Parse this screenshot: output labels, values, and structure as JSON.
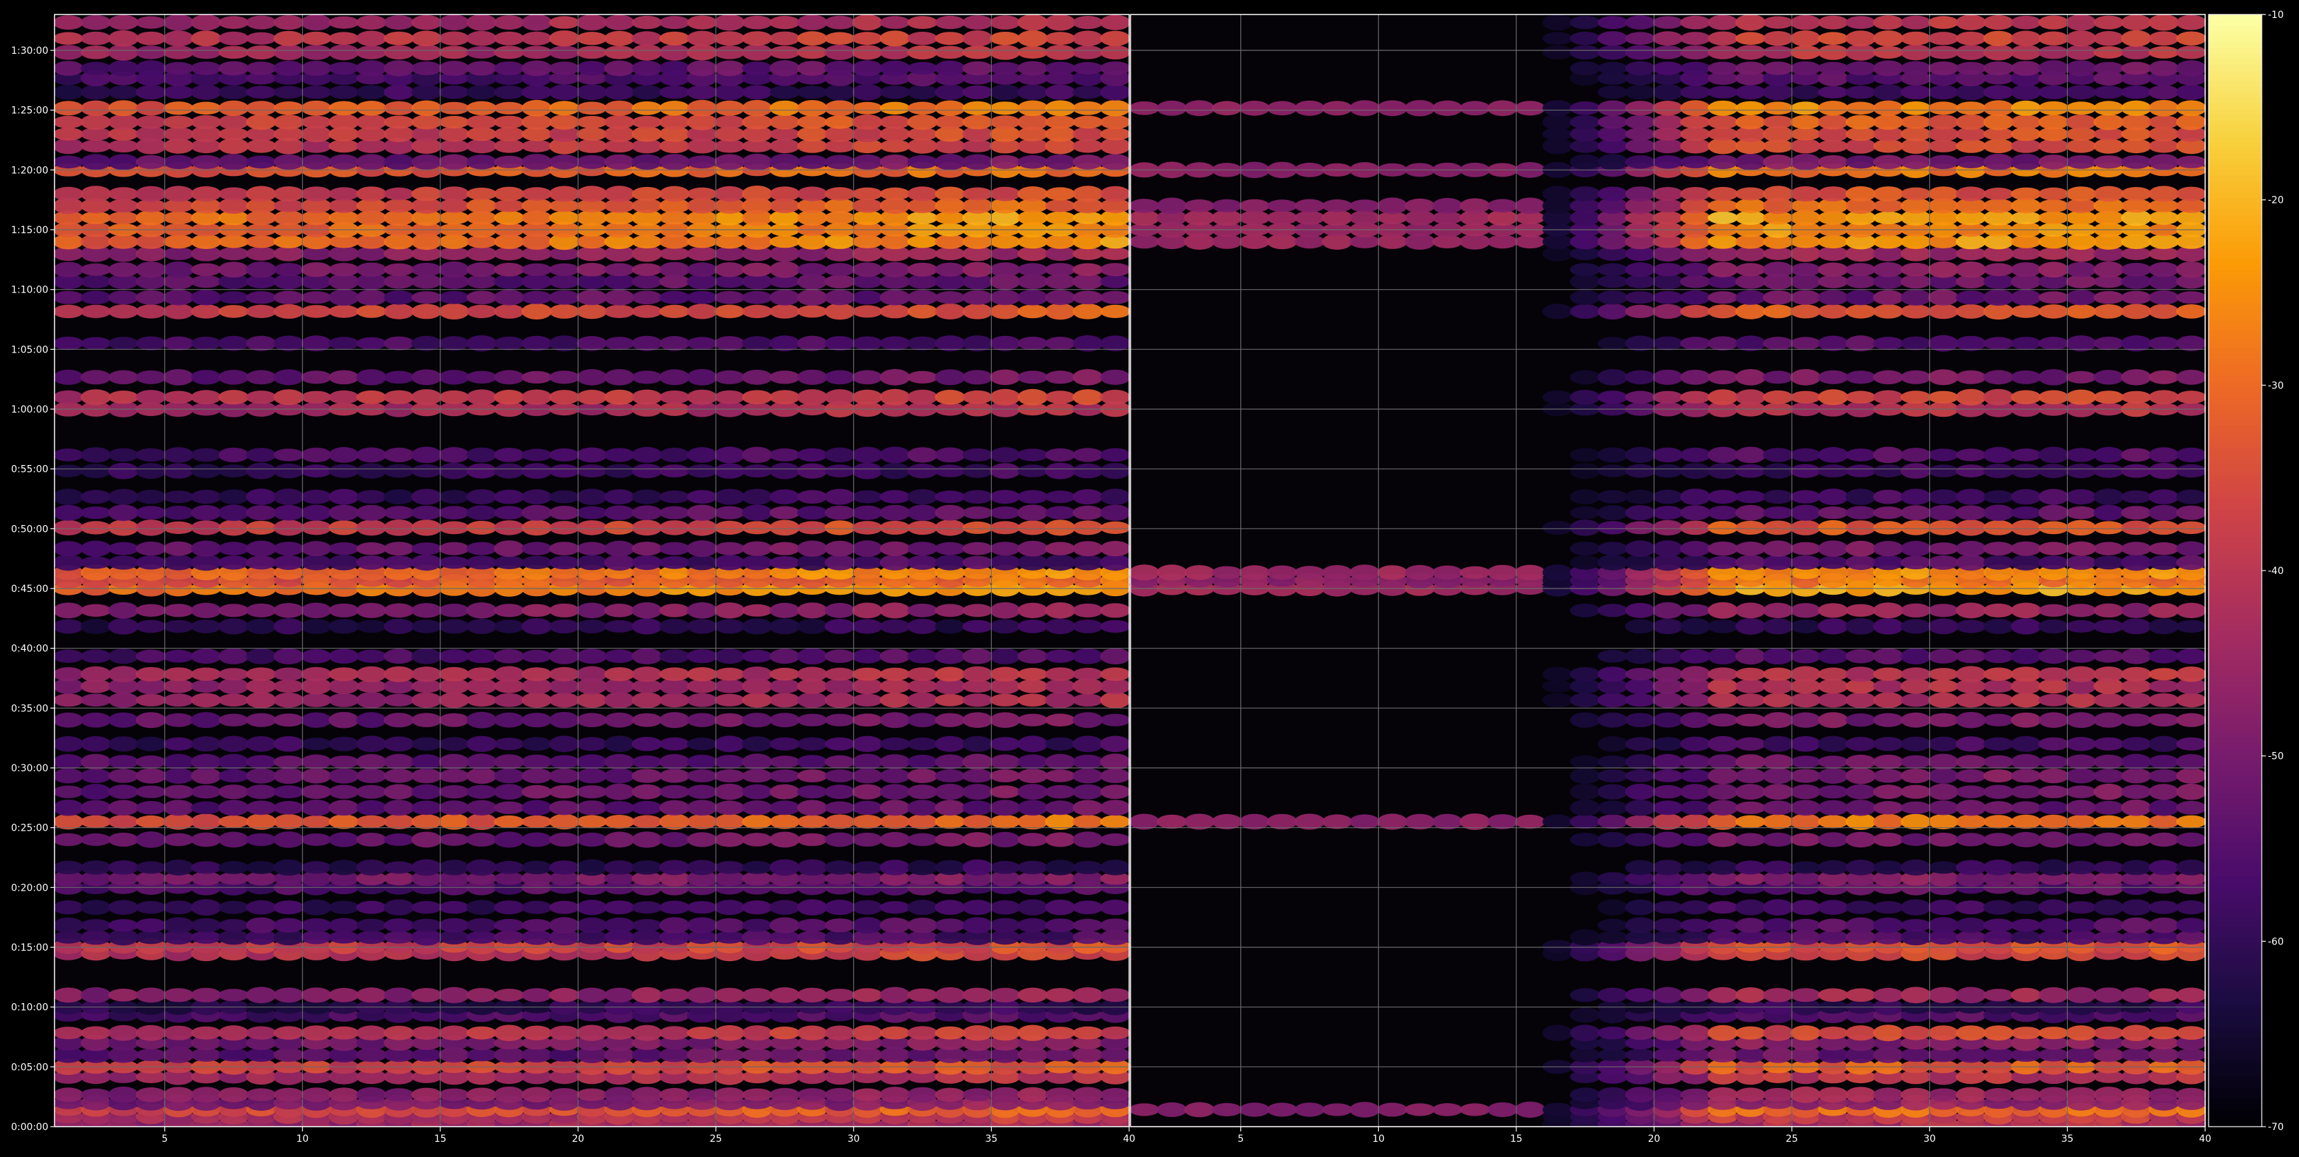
{
  "chart_data": {
    "type": "heatmap",
    "background": "#000000",
    "colormap": "inferno",
    "colormap_stops": [
      "#000004",
      "#1b0c41",
      "#4a0c6b",
      "#781c6d",
      "#a52c60",
      "#cf4446",
      "#ed6925",
      "#fb9b06",
      "#f7d13d",
      "#fcffa4"
    ],
    "grid": true,
    "grid_color": "#6a6a6a",
    "panels": [
      {
        "id": "left",
        "x_ticks": [
          5,
          10,
          15,
          20,
          25,
          30,
          35,
          40
        ],
        "x_range": [
          1,
          40
        ],
        "columns": 39,
        "intensity_profile": "full"
      },
      {
        "id": "right",
        "x_ticks": [
          5,
          10,
          15,
          20,
          25,
          30,
          35,
          40
        ],
        "x_range": [
          1,
          40
        ],
        "columns": 39,
        "intensity_profile": "ramp"
      }
    ],
    "y_axis": {
      "range_seconds": [
        0,
        5580
      ],
      "tick_labels": [
        "0:00:00",
        "0:05:00",
        "0:10:00",
        "0:15:00",
        "0:20:00",
        "0:25:00",
        "0:30:00",
        "0:35:00",
        "0:40:00",
        "0:45:00",
        "0:50:00",
        "0:55:00",
        "1:00:00",
        "1:05:00",
        "1:10:00",
        "1:15:00",
        "1:20:00",
        "1:25:00",
        "1:30:00"
      ],
      "tick_seconds": [
        0,
        300,
        600,
        900,
        1200,
        1500,
        1800,
        2100,
        2400,
        2700,
        3000,
        3300,
        3600,
        3900,
        4200,
        4500,
        4800,
        5100,
        5400
      ]
    },
    "colorbar": {
      "range": [
        -70,
        -10
      ],
      "tick_labels": [
        "-70",
        "-60",
        "-50",
        "-40",
        "-30",
        "-20",
        "-10"
      ],
      "tick_values": [
        -70,
        -60,
        -50,
        -40,
        -30,
        -20,
        -10
      ]
    },
    "bands": [
      {
        "t": 15,
        "level": -42
      },
      {
        "t": 50,
        "level": -38
      },
      {
        "t": 85,
        "level": -30
      },
      {
        "t": 120,
        "level": -47
      },
      {
        "t": 160,
        "level": -45
      },
      {
        "t": 250,
        "level": -40
      },
      {
        "t": 300,
        "level": -32
      },
      {
        "t": 360,
        "level": -52
      },
      {
        "t": 420,
        "level": -48
      },
      {
        "t": 470,
        "level": -36
      },
      {
        "t": 560,
        "level": -55
      },
      {
        "t": 600,
        "level": -60
      },
      {
        "t": 660,
        "level": -44
      },
      {
        "t": 870,
        "level": -36
      },
      {
        "t": 905,
        "level": -34
      },
      {
        "t": 950,
        "level": -56
      },
      {
        "t": 1010,
        "level": -55
      },
      {
        "t": 1100,
        "level": -58
      },
      {
        "t": 1200,
        "level": -54
      },
      {
        "t": 1245,
        "level": -48
      },
      {
        "t": 1300,
        "level": -60
      },
      {
        "t": 1440,
        "level": -50
      },
      {
        "t": 1530,
        "level": -28
      },
      {
        "t": 1600,
        "level": -52
      },
      {
        "t": 1680,
        "level": -50
      },
      {
        "t": 1760,
        "level": -50
      },
      {
        "t": 1830,
        "level": -52
      },
      {
        "t": 1920,
        "level": -58
      },
      {
        "t": 2040,
        "level": -50
      },
      {
        "t": 2140,
        "level": -42
      },
      {
        "t": 2210,
        "level": -42
      },
      {
        "t": 2270,
        "level": -40
      },
      {
        "t": 2360,
        "level": -55
      },
      {
        "t": 2510,
        "level": -60
      },
      {
        "t": 2590,
        "level": -46
      },
      {
        "t": 2700,
        "level": -22
      },
      {
        "t": 2740,
        "level": -28
      },
      {
        "t": 2780,
        "level": -24
      },
      {
        "t": 2830,
        "level": -56
      },
      {
        "t": 2900,
        "level": -50
      },
      {
        "t": 3005,
        "level": -33
      },
      {
        "t": 3080,
        "level": -53
      },
      {
        "t": 3160,
        "level": -58
      },
      {
        "t": 3290,
        "level": -58
      },
      {
        "t": 3370,
        "level": -55
      },
      {
        "t": 3600,
        "level": -40
      },
      {
        "t": 3660,
        "level": -36
      },
      {
        "t": 3760,
        "level": -50
      },
      {
        "t": 3930,
        "level": -55
      },
      {
        "t": 4090,
        "level": -32
      },
      {
        "t": 4160,
        "level": -52
      },
      {
        "t": 4240,
        "level": -52
      },
      {
        "t": 4300,
        "level": -48
      },
      {
        "t": 4380,
        "level": -44
      },
      {
        "t": 4440,
        "level": -24
      },
      {
        "t": 4500,
        "level": -24
      },
      {
        "t": 4560,
        "level": -22
      },
      {
        "t": 4620,
        "level": -30
      },
      {
        "t": 4680,
        "level": -34
      },
      {
        "t": 4800,
        "level": -28
      },
      {
        "t": 4840,
        "level": -50
      },
      {
        "t": 4920,
        "level": -36
      },
      {
        "t": 4980,
        "level": -34
      },
      {
        "t": 5040,
        "level": -32
      },
      {
        "t": 5110,
        "level": -26
      },
      {
        "t": 5190,
        "level": -58
      },
      {
        "t": 5260,
        "level": -55
      },
      {
        "t": 5310,
        "level": -52
      },
      {
        "t": 5390,
        "level": -40
      },
      {
        "t": 5460,
        "level": -36
      },
      {
        "t": 5540,
        "level": -40
      }
    ]
  }
}
